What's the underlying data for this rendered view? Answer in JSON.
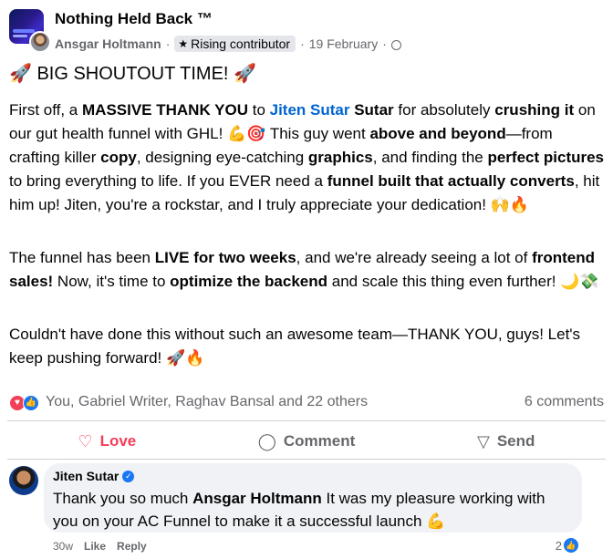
{
  "post": {
    "group_name": "Nothing Held Back ™",
    "author": "Ansgar Holtmann",
    "separator": "·",
    "badge": "Rising contributor",
    "date": "19 February",
    "date_separator": "·",
    "title": "🚀 BIG SHOUTOUT TIME! 🚀",
    "p1": {
      "t1": "First off, a ",
      "b1": "MASSIVE THANK YOU",
      "t2": " to ",
      "mention": "Jiten Sutar",
      "mention_tail": " Sutar",
      "t3": " for absolutely ",
      "b2": "crushing it",
      "t4": " on our gut health funnel with GHL! 💪🎯 This guy went ",
      "b3": "above and beyond",
      "t5": "—from crafting killer ",
      "b4": "copy",
      "t6": ", designing eye-catching ",
      "b5": "graphics",
      "t7": ", and finding the ",
      "b6": "perfect pictures",
      "t8": " to bring everything to life. If you EVER need a ",
      "b7": "funnel built that actually converts",
      "t9": ", hit him up! Jiten, you're a rockstar, and I truly appreciate your dedication! 🙌🔥"
    },
    "p2": {
      "t1": "The funnel has been ",
      "b1": "LIVE for two weeks",
      "t2": ", and we're already seeing a lot of ",
      "b2": "frontend sales!",
      "t3": " Now, it's time to ",
      "b3": "optimize the backend",
      "t4": " and scale this thing even further! 🌙💸"
    },
    "p3": "Couldn't have done this without such an awesome team—THANK YOU, guys! Let's keep pushing forward! 🚀🔥"
  },
  "reactions": {
    "names": "You, Gabriel Writer, Raghav Bansal and 22 others",
    "comments": "6 comments"
  },
  "actions": {
    "love": "Love",
    "comment": "Comment",
    "send": "Send"
  },
  "comment": {
    "author": "Jiten Sutar",
    "t1": "Thank you so much ",
    "mention": "Ansgar Holtmann",
    "t2": " It was my pleasure working with you on your AC Funnel to make it a successful launch 💪",
    "time": "30w",
    "like": "Like",
    "reply": "Reply",
    "likes": "2"
  },
  "colors": {
    "accent": "#1877f2",
    "love": "#f33e58",
    "muted": "#65676b",
    "bubble": "#f0f2f5"
  },
  "icons": {
    "badge": "star-icon",
    "privacy": "globe-icon",
    "love": "heart-icon",
    "comment": "speech-bubble-icon",
    "send": "send-icon"
  }
}
